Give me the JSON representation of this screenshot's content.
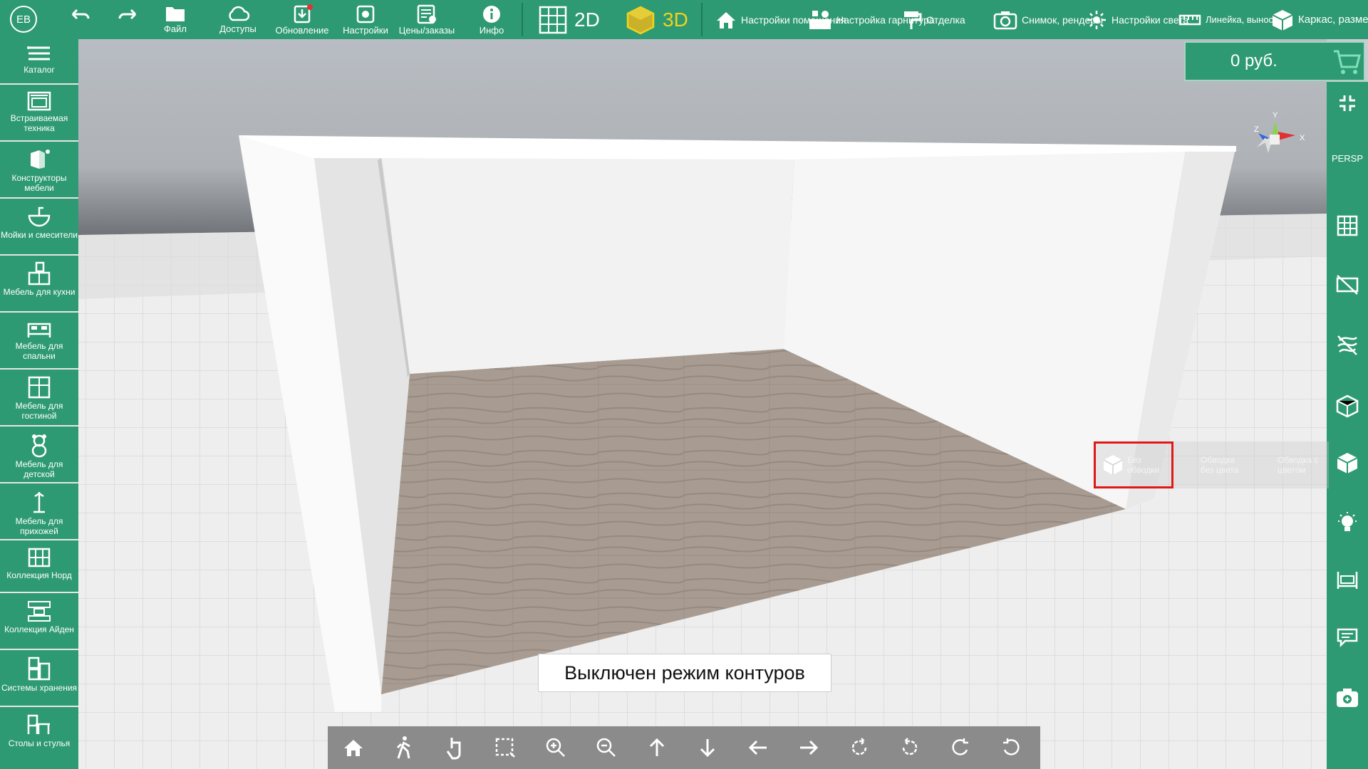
{
  "topbar": {
    "avatar": "EB",
    "file": "Файл",
    "access": "Доступы",
    "update": "Обновление",
    "settings": "Настройки",
    "prices": "Цены/заказы",
    "info": "Инфо",
    "mode2d": "2D",
    "mode3d": "3D",
    "room_settings": "Настройки помещения",
    "furniture_settings": "Настройка гарнитура",
    "finishing": "Отделка",
    "snapshot": "Снимок, рендеры",
    "light_settings": "Настройки света",
    "ruler": "Линейка, выноски",
    "frame": "Каркас, размеры"
  },
  "price": {
    "value": "0 руб."
  },
  "sidebar": {
    "items": [
      {
        "label": "Каталог"
      },
      {
        "label": "Встраиваемая техника"
      },
      {
        "label": "Конструкторы мебели"
      },
      {
        "label": "Мойки и смесители"
      },
      {
        "label": "Мебель для кухни"
      },
      {
        "label": "Мебель для спальни"
      },
      {
        "label": "Мебель для гостиной"
      },
      {
        "label": "Мебель для детской"
      },
      {
        "label": "Мебель для прихожей"
      },
      {
        "label": "Коллекция Норд"
      },
      {
        "label": "Коллекция Айден"
      },
      {
        "label": "Системы хранения"
      },
      {
        "label": "Столы и стулья"
      }
    ]
  },
  "rightbar": {
    "persp": "PERSP"
  },
  "gizmo": {
    "x": "X",
    "y": "Y",
    "z": "Z"
  },
  "outline_modes": {
    "none": "Без обводки",
    "no_color": "Обводка без цвета",
    "with_color": "Обводка с цветом"
  },
  "toast": "Выключен режим контуров",
  "colors": {
    "primary": "#2e9a73",
    "accent_3d": "#f2d21b",
    "selection": "#e01818"
  }
}
